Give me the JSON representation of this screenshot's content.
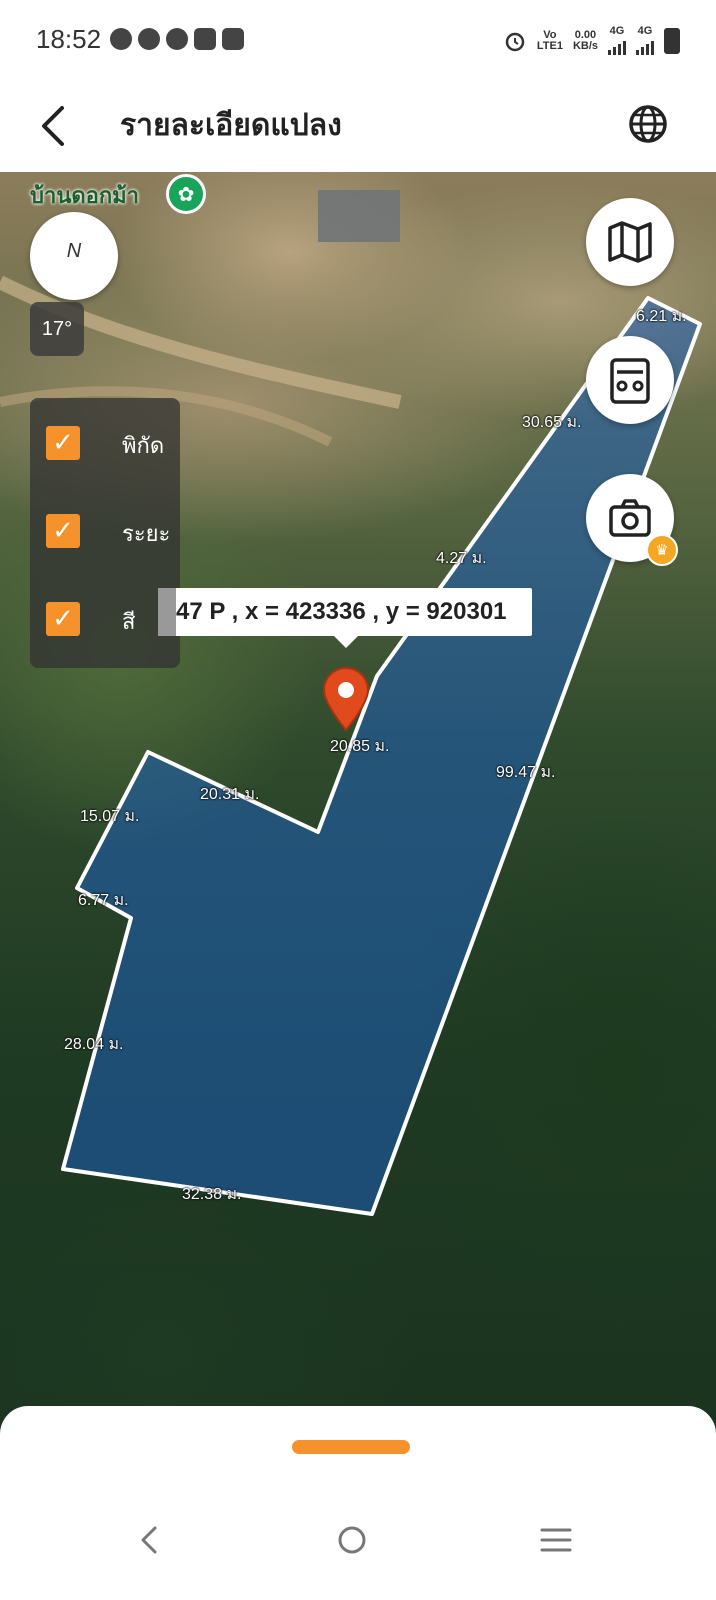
{
  "status_bar": {
    "time": "18:52",
    "net_label_1": "Vo",
    "net_label_2": "LTE1",
    "speed_value": "0.00",
    "speed_unit": "KB/s",
    "signal_1_label": "4G",
    "signal_2_label": "4G"
  },
  "app_bar": {
    "title": "รายละเอียดแปลง"
  },
  "map": {
    "place_label": "บ้านดอกม้า",
    "temperature": "17°",
    "compass_label": "N",
    "layers": [
      {
        "label": "พิกัด",
        "checked": true
      },
      {
        "label": "ระยะ",
        "checked": true
      },
      {
        "label": "สี",
        "checked": true
      }
    ],
    "coordinate_text": "47 P , x = 423336 , y = 920301",
    "distances": {
      "d1": "6.21 ม.",
      "d2": "30.65 ม.",
      "d3": "4.27 ม.",
      "d4": "20.85 ม.",
      "d5": "99.47 ม.",
      "d6": "20.31 ม.",
      "d7": "15.07 ม.",
      "d8": "6.77 ม.",
      "d9": "28.04 ม.",
      "d10": "32.38 ม."
    },
    "parcel_fill_color": "#1e5fb8",
    "parcel_stroke_color": "#ffffff",
    "marker_color": "#e04a1c"
  },
  "colors": {
    "accent": "#f5922b",
    "crown": "#f5a623"
  },
  "icons": {
    "back": "back-arrow-icon",
    "globe": "globe-icon",
    "map": "map-icon",
    "calculator": "calculator-icon",
    "camera": "camera-icon",
    "crown": "crown-icon",
    "village": "village-icon"
  }
}
